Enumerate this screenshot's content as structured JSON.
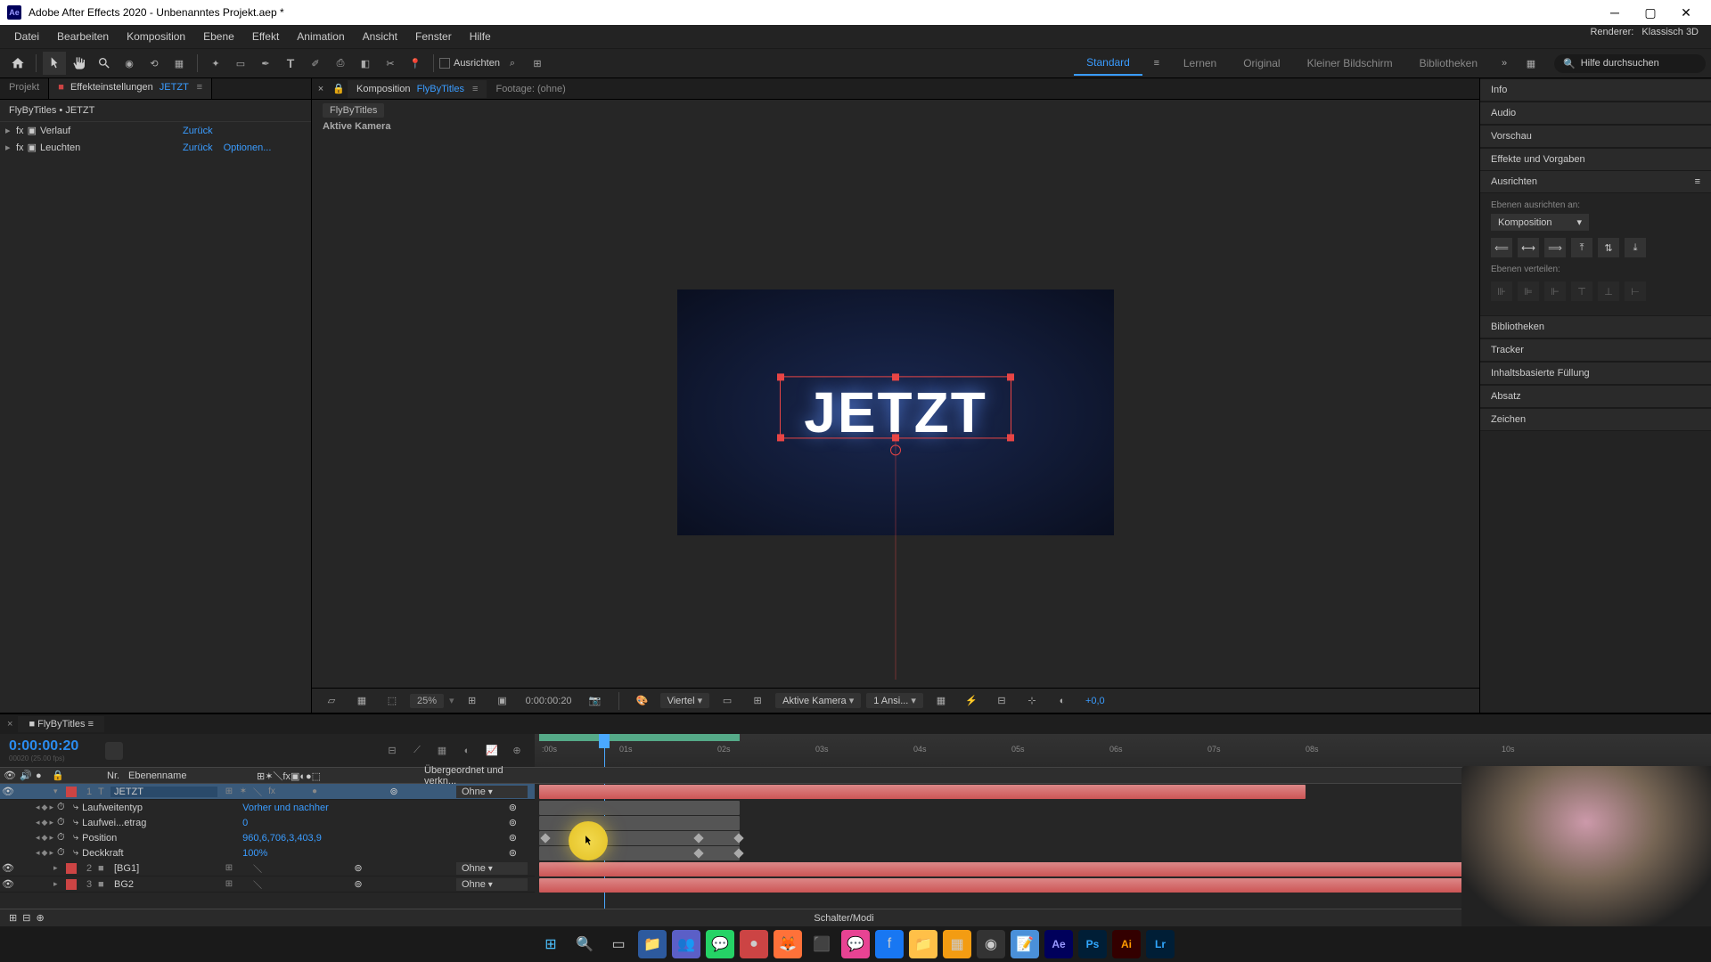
{
  "window": {
    "title": "Adobe After Effects 2020 - Unbenanntes Projekt.aep *"
  },
  "menu": {
    "items": [
      "Datei",
      "Bearbeiten",
      "Komposition",
      "Ebene",
      "Effekt",
      "Animation",
      "Ansicht",
      "Fenster",
      "Hilfe"
    ]
  },
  "toolbar": {
    "align_label": "Ausrichten"
  },
  "workspaces": {
    "items": [
      "Standard",
      "Lernen",
      "Original",
      "Kleiner Bildschirm",
      "Bibliotheken"
    ],
    "active": "Standard",
    "help_placeholder": "Hilfe durchsuchen"
  },
  "left": {
    "tabs": {
      "project": "Projekt",
      "fx": "Effekteinstellungen",
      "layer": "JETZT"
    },
    "breadcrumb": "FlyByTitles • JETZT",
    "effects": [
      {
        "name": "Verlauf",
        "reset": "Zurück"
      },
      {
        "name": "Leuchten",
        "reset": "Zurück",
        "options": "Optionen..."
      }
    ]
  },
  "comp": {
    "tab_prefix": "Komposition",
    "tab_name": "FlyByTitles",
    "footage_tab": "Footage: (ohne)",
    "breadcrumb": "FlyByTitles",
    "active_camera": "Aktive Kamera",
    "text": "JETZT",
    "renderer_label": "Renderer:",
    "renderer_value": "Klassisch 3D"
  },
  "viewer": {
    "zoom": "25%",
    "time": "0:00:00:20",
    "res": "Viertel",
    "cam": "Aktive Kamera",
    "views": "1 Ansi...",
    "exposure": "+0,0"
  },
  "right": {
    "panels": [
      "Info",
      "Audio",
      "Vorschau",
      "Effekte und Vorgaben"
    ],
    "align": {
      "title": "Ausrichten",
      "layers_label": "Ebenen ausrichten an:",
      "target": "Komposition",
      "distribute_label": "Ebenen verteilen:"
    },
    "panels2": [
      "Bibliotheken",
      "Tracker",
      "Inhaltsbasierte Füllung",
      "Absatz",
      "Zeichen"
    ]
  },
  "timeline": {
    "tab": "FlyByTitles",
    "timecode": "0:00:00:20",
    "sub": "00020 (25.00 fps)",
    "cols": {
      "nr": "Nr.",
      "name": "Ebenenname",
      "parent": "Übergeordnet und verkn..."
    },
    "ruler": [
      ":00s",
      "01s",
      "02s",
      "03s",
      "04s",
      "05s",
      "06s",
      "07s",
      "08s",
      "10s"
    ],
    "layers": [
      {
        "num": "1",
        "name": "JETZT",
        "type": "T",
        "parent": "Ohne",
        "selected": true
      },
      {
        "num": "2",
        "name": "[BG1]",
        "type": "S",
        "parent": "Ohne"
      },
      {
        "num": "3",
        "name": "BG2",
        "type": "S",
        "parent": "Ohne"
      }
    ],
    "props": [
      {
        "name": "Laufweitentyp",
        "value": "Vorher und nachher"
      },
      {
        "name": "Laufwei...etrag",
        "value": "0"
      },
      {
        "name": "Position",
        "value": "960,6,706,3,403,9"
      },
      {
        "name": "Deckkraft",
        "value": "100%"
      }
    ],
    "footer": "Schalter/Modi"
  }
}
